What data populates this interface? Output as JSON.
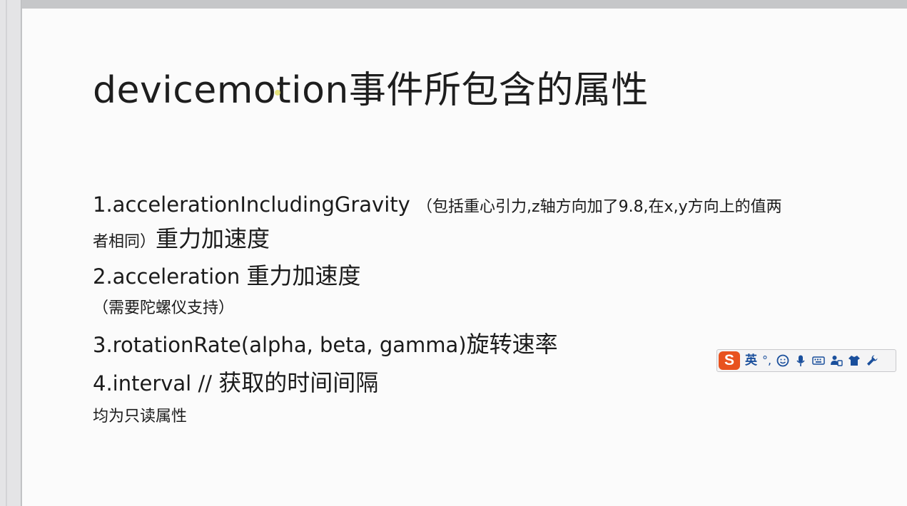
{
  "slide": {
    "title": "devicemotion事件所包含的属性",
    "item1": {
      "label": "1.accelerationIncludingGravity",
      "note": "（包括重心引力,z轴方向加了9.8,在x,y方向上的值两",
      "note_cont": "者相同）",
      "desc": "重力加速度"
    },
    "item2": {
      "label": "2.acceleration",
      "desc": "重力加速度",
      "note": "（需要陀螺仪支持）"
    },
    "item3": {
      "label": "3.rotationRate(alpha, beta, gamma)",
      "desc": "旋转速率"
    },
    "item4": {
      "label": "4.interval //",
      "desc": "获取的时间间隔"
    },
    "footer_note": "均为只读属性"
  },
  "ime_toolbar": {
    "logo": "S",
    "language": "英",
    "punct": "°,",
    "icons": [
      "emoji-icon",
      "microphone-icon",
      "keyboard-icon",
      "user-tools-icon",
      "skin-shirt-icon",
      "settings-wrench-icon"
    ],
    "accent": "#e8521f",
    "icon_color": "#1a4f9c"
  }
}
